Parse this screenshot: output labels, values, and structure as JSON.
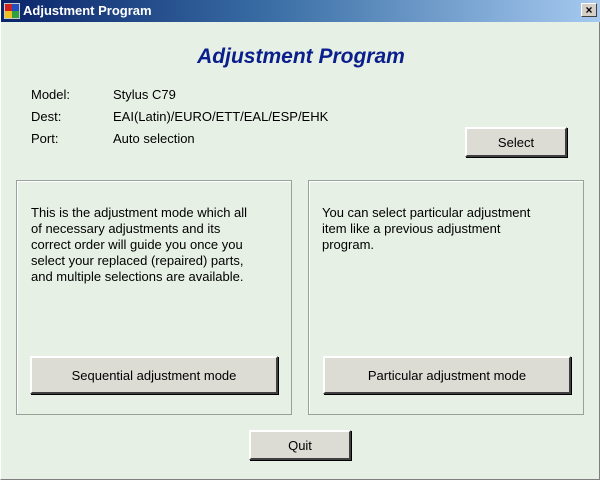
{
  "window": {
    "title": "Adjustment Program",
    "close_glyph": "×",
    "icon": "app-icon"
  },
  "heading": "Adjustment Program",
  "info": {
    "model_label": "Model:",
    "model_value": "Stylus C79",
    "dest_label": "Dest:",
    "dest_value": "EAI(Latin)/EURO/ETT/EAL/ESP/EHK",
    "port_label": "Port:",
    "port_value": "Auto selection"
  },
  "select_button": "Select",
  "sequential": {
    "description": "This is the adjustment mode which all\nof necessary adjustments and its\ncorrect order will guide you once you\nselect your replaced (repaired) parts,\nand multiple selections are available.",
    "button": "Sequential adjustment mode"
  },
  "particular": {
    "description": "You can select particular adjustment\nitem like a previous adjustment\nprogram.",
    "button": "Particular adjustment mode"
  },
  "quit_button": "Quit",
  "colors": {
    "title_bar_start": "#0a246a",
    "title_bar_end": "#a6caf0",
    "heading": "#0a1e8c",
    "background": "#e6f0e4"
  }
}
